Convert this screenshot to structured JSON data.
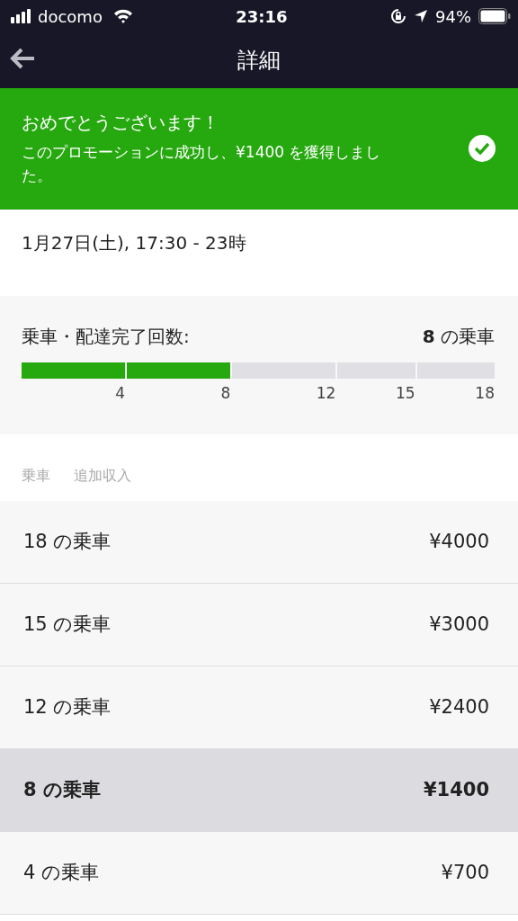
{
  "status_bar": {
    "carrier": "docomo",
    "time": "23:16",
    "battery": "94%"
  },
  "nav": {
    "title": "詳細"
  },
  "banner": {
    "title": "おめでとうございます！",
    "message": "このプロモーションに成功し、¥1400 を獲得しました。",
    "checked": true
  },
  "period": "1月27日(土), 17:30 - 23時",
  "progress": {
    "label": "乗車・配達完了回数:",
    "value": "**8** の乗車",
    "segments": [
      {
        "tick": "4",
        "filled": true
      },
      {
        "tick": "8",
        "filled": true
      },
      {
        "tick": "12",
        "filled": false
      },
      {
        "tick": "15",
        "filled": false
      },
      {
        "tick": "18",
        "filled": false
      }
    ]
  },
  "columns": [
    "乗車",
    "追加収入"
  ],
  "tiers": [
    {
      "rides": "18 の乗車",
      "amount": "¥4000",
      "selected": false
    },
    {
      "rides": "15 の乗車",
      "amount": "¥3000",
      "selected": false
    },
    {
      "rides": "12 の乗車",
      "amount": "¥2400",
      "selected": false
    },
    {
      "rides": "8 の乗車",
      "amount": "¥1400",
      "selected": true
    },
    {
      "rides": "4 の乗車",
      "amount": "¥700",
      "selected": false
    }
  ]
}
